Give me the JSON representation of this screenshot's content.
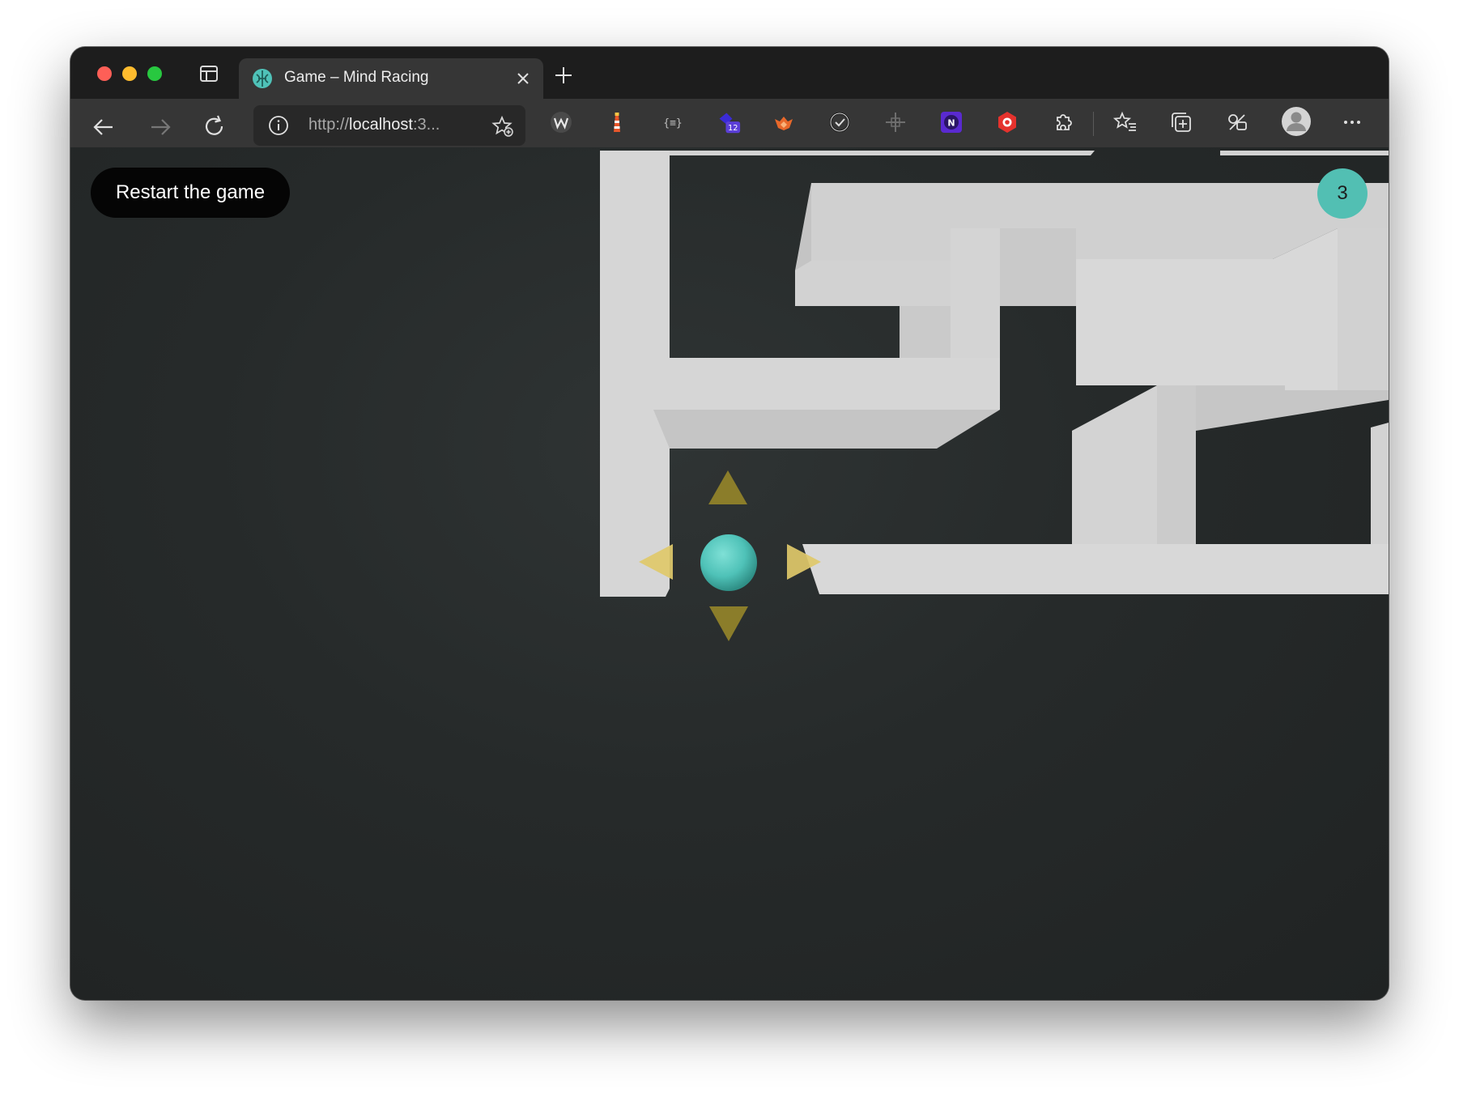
{
  "browser": {
    "tab": {
      "title": "Game – Mind Racing",
      "favicon": "mind-racing-logo-icon"
    },
    "address": {
      "prefix": "http://",
      "host": "localhost",
      "suffix": ":3..."
    },
    "extensions": [
      {
        "name": "w-extension-icon"
      },
      {
        "name": "lighthouse-extension-icon"
      },
      {
        "name": "json-formatter-extension-icon"
      },
      {
        "name": "purple-extension-icon",
        "badge": "12"
      },
      {
        "name": "orange-fox-extension-icon"
      },
      {
        "name": "circle-check-extension-icon"
      },
      {
        "name": "crosshair-extension-icon"
      },
      {
        "name": "n-extension-icon",
        "letter": "N"
      },
      {
        "name": "hexagon-extension-icon"
      }
    ]
  },
  "game": {
    "restart_label": "Restart the game",
    "level": "3",
    "colors": {
      "background": "#262828",
      "wall": "#d7d7d7",
      "ball": "#4fc2b8",
      "arrow_active": "#8b7d2a",
      "arrow_dim": "#dfc96a",
      "badge": "#52bfb3"
    },
    "controls": [
      "up-arrow-icon",
      "down-arrow-icon",
      "left-arrow-icon",
      "right-arrow-icon"
    ]
  }
}
